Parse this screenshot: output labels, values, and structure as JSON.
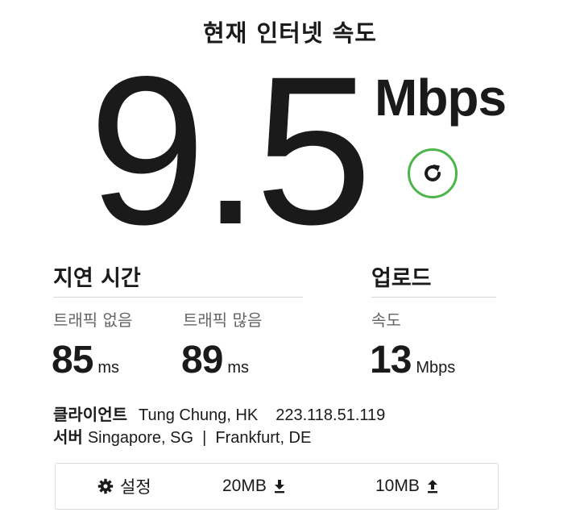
{
  "header": {
    "title": "현재 인터넷 속도"
  },
  "speed": {
    "value": "9.5",
    "unit": "Mbps"
  },
  "latency": {
    "title": "지연 시간",
    "unloaded": {
      "label": "트래픽 없음",
      "value": "85",
      "unit": "ms"
    },
    "loaded": {
      "label": "트래픽 많음",
      "value": "89",
      "unit": "ms"
    }
  },
  "upload": {
    "title": "업로드",
    "label": "속도",
    "value": "13",
    "unit": "Mbps"
  },
  "client": {
    "label": "클라이언트",
    "location": "Tung Chung, HK",
    "ip": "223.118.51.119"
  },
  "server": {
    "label": "서버",
    "locations": "Singapore, SG  |  Frankfurt, DE"
  },
  "toolbar": {
    "settings_label": "설정",
    "download_size": "20MB",
    "upload_size": "10MB"
  },
  "colors": {
    "refresh_ring": "#4cb54a",
    "text": "#1a1a1a",
    "muted": "#666666"
  },
  "icons": {
    "refresh": "refresh-icon",
    "settings": "gear-icon",
    "download": "download-arrow-icon",
    "upload": "upload-arrow-icon"
  }
}
